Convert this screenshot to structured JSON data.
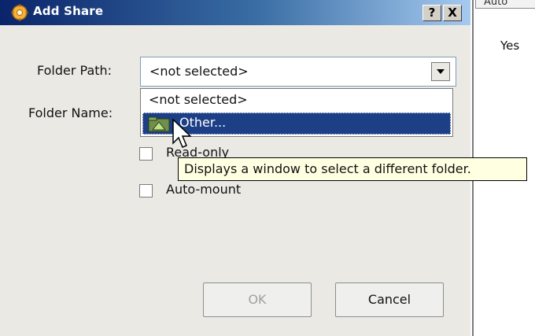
{
  "dialog": {
    "title": "Add Share",
    "help_button": "?",
    "close_button": "X"
  },
  "form": {
    "folder_path_label": "Folder Path:",
    "folder_path_value": "<not selected>",
    "folder_name_label": "Folder Name:",
    "readonly_label": "Read-only",
    "automount_label": "Auto-mount"
  },
  "dropdown": {
    "options": [
      "<not selected>",
      "Other..."
    ],
    "highlighted": "Other..."
  },
  "tooltip": {
    "text": "Displays a window to select a different folder."
  },
  "buttons": {
    "ok": "OK",
    "cancel": "Cancel"
  },
  "background_window": {
    "column_header": "Auto",
    "cell_value": "Yes"
  }
}
